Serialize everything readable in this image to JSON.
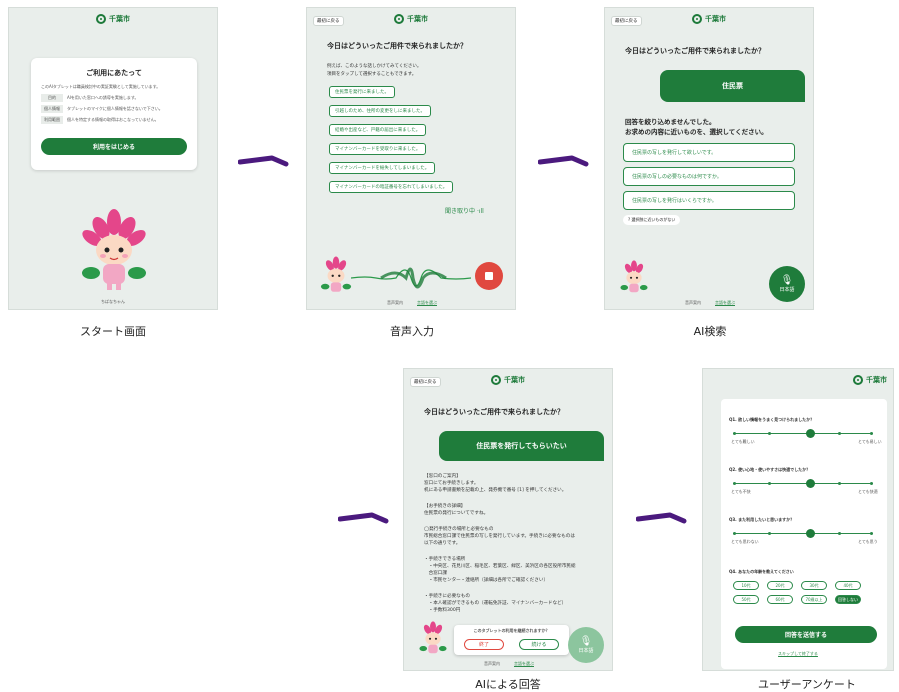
{
  "captions": {
    "start": "スタート画面",
    "voice": "音声入力",
    "ai_search": "AI検索",
    "ai_answer": "AIによる回答",
    "survey": "ユーザーアンケート"
  },
  "logo_text": "千葉市",
  "top_button": "最初に戻る",
  "start": {
    "card_title": "ご利用にあたって",
    "card_intro": "このAIタブレットは職員検討中の実証実験として実施しています。",
    "rows": [
      {
        "tag": "目的",
        "text": "AIを用いた窓口への誘導を実施します。"
      },
      {
        "tag": "個人情報",
        "text": "タブレットのマイクに個人情報を話さないで下さい。"
      },
      {
        "tag": "利用範囲",
        "text": "個人を特定する情報の取得はおこなっていません。"
      }
    ],
    "start_button": "利用をはじめる",
    "mascot_name": "ちばなちゃん"
  },
  "voice": {
    "question": "今日はどういったご用件で来られましたか？",
    "hint1": "例えば、このような話しかけてみてください。",
    "hint2": "項目をタップして選択することもできます。",
    "options": [
      "住民票を発行に来ました。",
      "引越しのため、住所の変更をしに来ました。",
      "結婚や出産など、戸籍の届出に来ました。",
      "マイナンバーカードを受取りに来ました。",
      "マイナンバーカードを紛失してしまいました。",
      "マイナンバーカードの暗証番号を忘れてしまいました。"
    ],
    "listening": "聞き取り中",
    "footer1": "音声案内",
    "footer2": "言語を選ぶ"
  },
  "ai_search": {
    "question": "今日はどういったご用件で来られましたか？",
    "bubble": "住民票",
    "msg1": "回答を絞り込めませんでした。",
    "msg2": "お求めの内容に近いものを、選択してください。",
    "options": [
      "住民票の写しを発行して欲しいです。",
      "住民票の写しの必要なものは何ですか。",
      "住民票の写しを発行はいくらですか。"
    ],
    "none": "選択肢に近いものがない",
    "mic_label": "日本語",
    "footer1": "音声案内",
    "footer2": "言語を選ぶ"
  },
  "ai_answer": {
    "question": "今日はどういったご用件で来られましたか？",
    "bubble": "住民票を発行してもらいたい",
    "lines": [
      "【窓口のご案内】",
      "窓口にてお手続きします。",
      "机にある申請書類を記載の上、発券機で番号 [1] を押してください。",
      "",
      "【お手続きの詳細】",
      "住民票の発行についてですね。",
      "",
      "◯発行手続きの場所と必要なもの",
      "市民総合窓口課で住民票の写しを発行しています。手続きに必要なものは",
      "以下の通りです。",
      "",
      "・手続きできる場所",
      "　・中央区、花見川区、稲毛区、若葉区、緑区、美浜区の各区役所市民総",
      "　合窓口課",
      "　・市民センター・連絡所（詳細は各所でご確認ください）",
      "",
      "・手続きに必要なもの",
      "　・本人確認ができるもの（運転免許証、マイナンバーカードなど）",
      "　・手数料300円"
    ],
    "confirm": "このタブレットの利用を継続されますか？",
    "end_btn": "終了",
    "continue_btn": "続ける",
    "mic_label": "日本語",
    "footer1": "音声案内",
    "footer2": "言語を選ぶ"
  },
  "survey": {
    "questions": [
      {
        "q": "Q1. 欲しい情報をうまく見つけられましたか？",
        "left": "とても難しい",
        "right": "とても易しい",
        "value": 0.55
      },
      {
        "q": "Q2. 使い心地・使いやすさは快適でしたか？",
        "left": "とても不快",
        "right": "とても快適",
        "value": 0.55
      },
      {
        "q": "Q3. また利用したいと思いますか？",
        "left": "とても思わない",
        "right": "とても思う",
        "value": 0.55
      }
    ],
    "age_q": "Q4. あなたの年齢を教えてください",
    "ages": [
      "10代",
      "20代",
      "30代",
      "40代",
      "50代",
      "60代",
      "70歳以上",
      "回答しない"
    ],
    "age_selected": 7,
    "submit": "回答を送信する",
    "skip": "スキップして終了する"
  }
}
